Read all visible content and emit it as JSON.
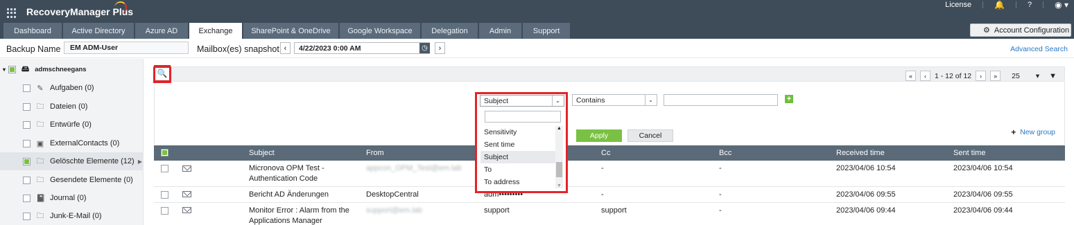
{
  "app": {
    "name": "RecoveryManager Plus"
  },
  "top_right": {
    "license": "License",
    "help": "?"
  },
  "tabs": [
    "Dashboard",
    "Active Directory",
    "Azure AD",
    "Exchange",
    "SharePoint & OneDrive",
    "Google Workspace",
    "Delegation",
    "Admin",
    "Support"
  ],
  "active_tab": "Exchange",
  "account_config": "Account Configuration",
  "backup": {
    "label": "Backup Name",
    "value": "EM ADM-User"
  },
  "snapshot": {
    "label": "Mailbox(es) snapshot",
    "date": "4/22/2023 0:00 AM"
  },
  "advanced_search": "Advanced Search",
  "sidebar": {
    "root": "admschneegans",
    "items": [
      {
        "label": "Aufgaben (0)",
        "icon": "task-icon"
      },
      {
        "label": "Dateien (0)",
        "icon": "folder-icon"
      },
      {
        "label": "Entwürfe (0)",
        "icon": "folder-icon"
      },
      {
        "label": "ExternalContacts (0)",
        "icon": "contact-card-icon"
      },
      {
        "label": "Gelöschte Elemente (12)",
        "icon": "folder-icon"
      },
      {
        "label": "Gesendete Elemente (0)",
        "icon": "folder-icon"
      },
      {
        "label": "Journal (0)",
        "icon": "journal-icon"
      },
      {
        "label": "Junk-E-Mail (0)",
        "icon": "folder-icon"
      }
    ]
  },
  "pager": {
    "range": "1 - 12 of 12",
    "per_page": "25"
  },
  "filter": {
    "field": "Subject",
    "operator": "Contains",
    "apply": "Apply",
    "cancel": "Cancel",
    "new_group": "New group",
    "dropdown_options": [
      "Sensitivity",
      "Sent time",
      "Subject",
      "To",
      "To address"
    ]
  },
  "table": {
    "columns": [
      "Subject",
      "From",
      "Cc",
      "Bcc",
      "Received time",
      "Sent time"
    ],
    "rows": [
      {
        "subject": "Micronova OPM Test -",
        "subject2": "Authentication Code",
        "from": "appcon_OPM_Test@em.lab",
        "to": "",
        "cc": "-",
        "bcc": "-",
        "received": "2023/04/06 10:54",
        "sent": "2023/04/06 10:54"
      },
      {
        "subject": "Bericht AD Änderungen",
        "subject2": "",
        "from": "DesktopCentral",
        "to": "adm•••••••••",
        "cc": "-",
        "bcc": "-",
        "received": "2023/04/06 09:55",
        "sent": "2023/04/06 09:55"
      },
      {
        "subject": "Monitor Error : Alarm from the",
        "subject2": "Applications Manager",
        "from": "support@em.lab",
        "to": "support",
        "cc": "support",
        "bcc": "-",
        "received": "2023/04/06 09:44",
        "sent": "2023/04/06 09:44"
      }
    ]
  }
}
